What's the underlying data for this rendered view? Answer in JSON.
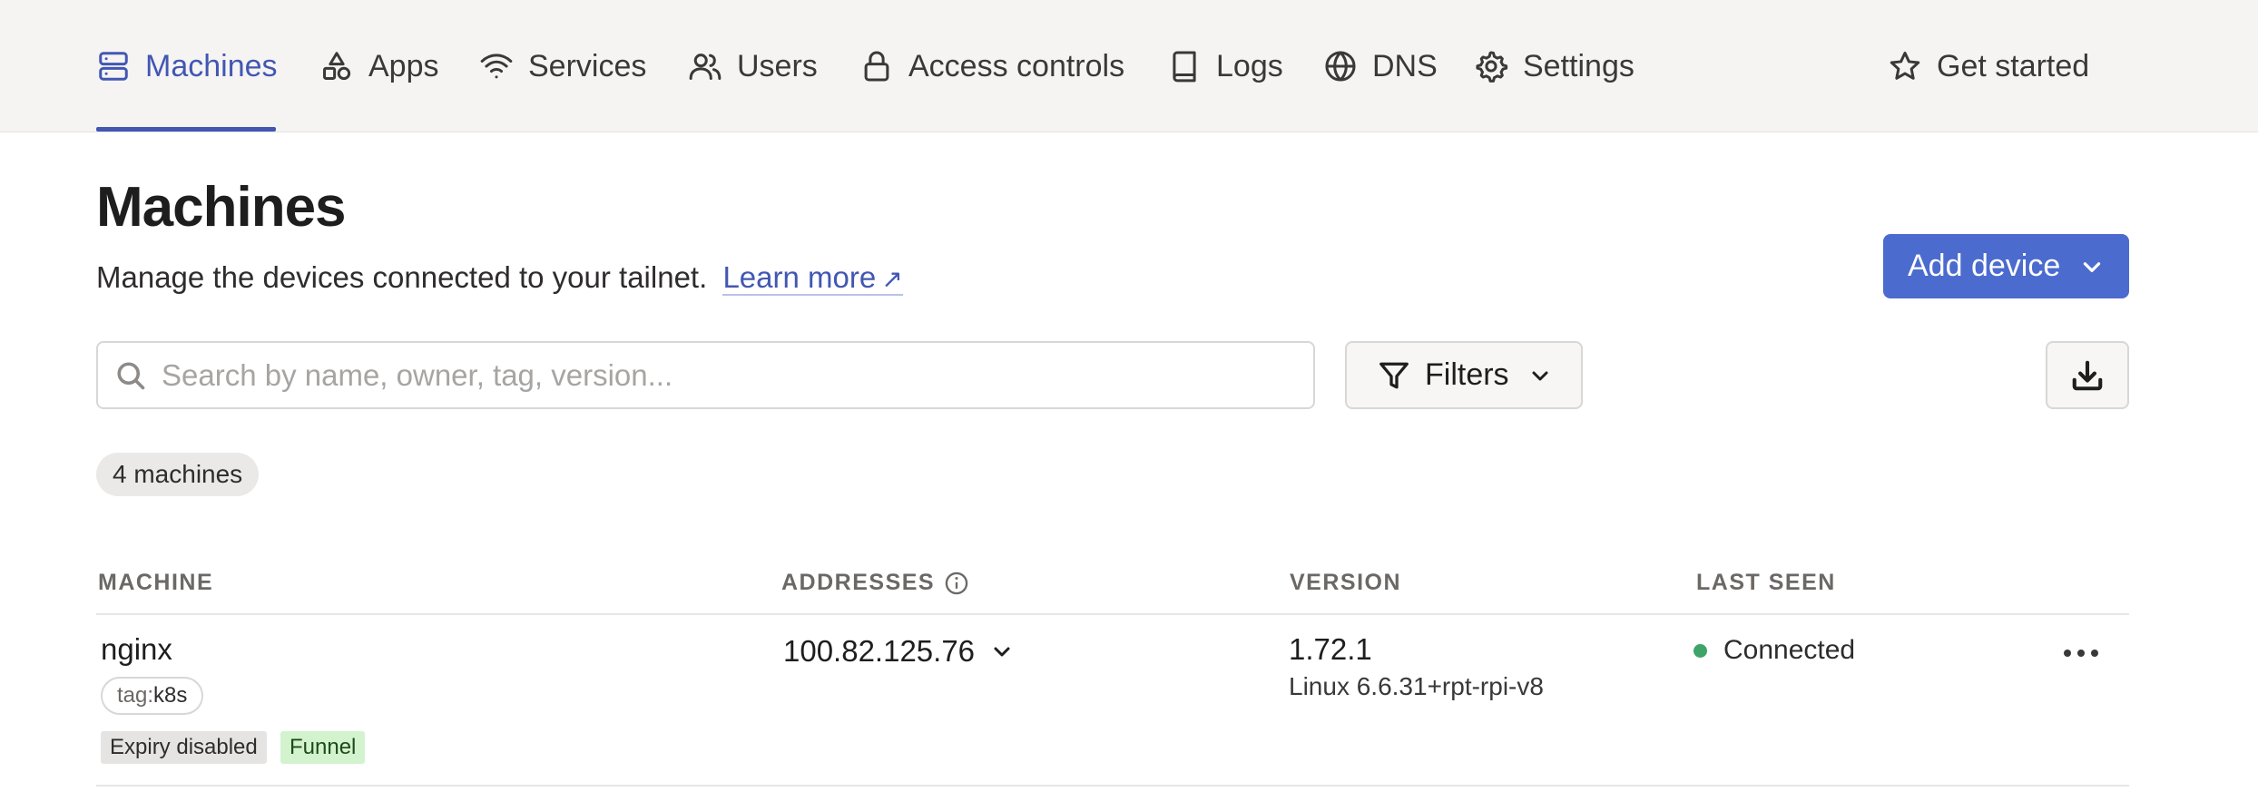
{
  "nav": {
    "items": [
      {
        "label": "Machines",
        "icon": "server-icon",
        "active": true
      },
      {
        "label": "Apps",
        "icon": "apps-icon"
      },
      {
        "label": "Services",
        "icon": "wifi-icon"
      },
      {
        "label": "Users",
        "icon": "users-icon"
      },
      {
        "label": "Access controls",
        "icon": "lock-icon"
      },
      {
        "label": "Logs",
        "icon": "book-icon"
      },
      {
        "label": "DNS",
        "icon": "globe-icon"
      },
      {
        "label": "Settings",
        "icon": "gear-icon"
      }
    ],
    "get_started": {
      "label": "Get started",
      "icon": "star-icon"
    }
  },
  "page": {
    "title": "Machines",
    "description": "Manage the devices connected to your tailnet.",
    "learn_more": "Learn more",
    "learn_more_arrow": "↗",
    "add_device": "Add device"
  },
  "search": {
    "placeholder": "Search by name, owner, tag, version...",
    "value": ""
  },
  "filters": {
    "label": "Filters"
  },
  "count_label": "4 machines",
  "table": {
    "columns": [
      "MACHINE",
      "ADDRESSES",
      "VERSION",
      "LAST SEEN"
    ],
    "rows": [
      {
        "name": "nginx",
        "tag_prefix": "tag:",
        "tag_value": "k8s",
        "badges": [
          "Expiry disabled",
          "Funnel"
        ],
        "address": "100.82.125.76",
        "version": "1.72.1",
        "os": "Linux 6.6.31+rpt-rpi-v8",
        "status": "Connected"
      }
    ]
  },
  "colors": {
    "accent": "#4257b2",
    "button": "#4b6bce",
    "connected": "#3fa46a",
    "funnel_badge": "#d3f3cf"
  }
}
